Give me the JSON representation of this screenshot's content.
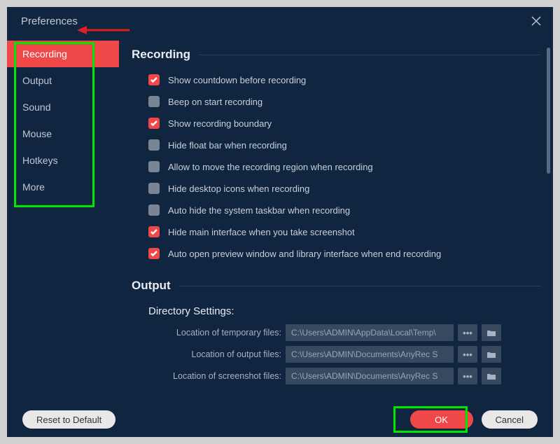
{
  "window": {
    "title": "Preferences"
  },
  "sidebar": {
    "items": [
      {
        "label": "Recording",
        "active": true
      },
      {
        "label": "Output",
        "active": false
      },
      {
        "label": "Sound",
        "active": false
      },
      {
        "label": "Mouse",
        "active": false
      },
      {
        "label": "Hotkeys",
        "active": false
      },
      {
        "label": "More",
        "active": false
      }
    ]
  },
  "sections": {
    "recording": {
      "title": "Recording",
      "options": [
        {
          "label": "Show countdown before recording",
          "checked": true
        },
        {
          "label": "Beep on start recording",
          "checked": false
        },
        {
          "label": "Show recording boundary",
          "checked": true
        },
        {
          "label": "Hide float bar when recording",
          "checked": false
        },
        {
          "label": "Allow to move the recording region when recording",
          "checked": false
        },
        {
          "label": "Hide desktop icons when recording",
          "checked": false
        },
        {
          "label": "Auto hide the system taskbar when recording",
          "checked": false
        },
        {
          "label": "Hide main interface when you take screenshot",
          "checked": true
        },
        {
          "label": "Auto open preview window and library interface when end recording",
          "checked": true
        }
      ]
    },
    "output": {
      "title": "Output",
      "subtitle": "Directory Settings:",
      "fields": [
        {
          "label": "Location of temporary files:",
          "value": "C:\\Users\\ADMIN\\AppData\\Local\\Temp\\"
        },
        {
          "label": "Location of output files:",
          "value": "C:\\Users\\ADMIN\\Documents\\AnyRec S"
        },
        {
          "label": "Location of screenshot files:",
          "value": "C:\\Users\\ADMIN\\Documents\\AnyRec S"
        }
      ]
    }
  },
  "footer": {
    "reset": "Reset to Default",
    "ok": "OK",
    "cancel": "Cancel"
  }
}
